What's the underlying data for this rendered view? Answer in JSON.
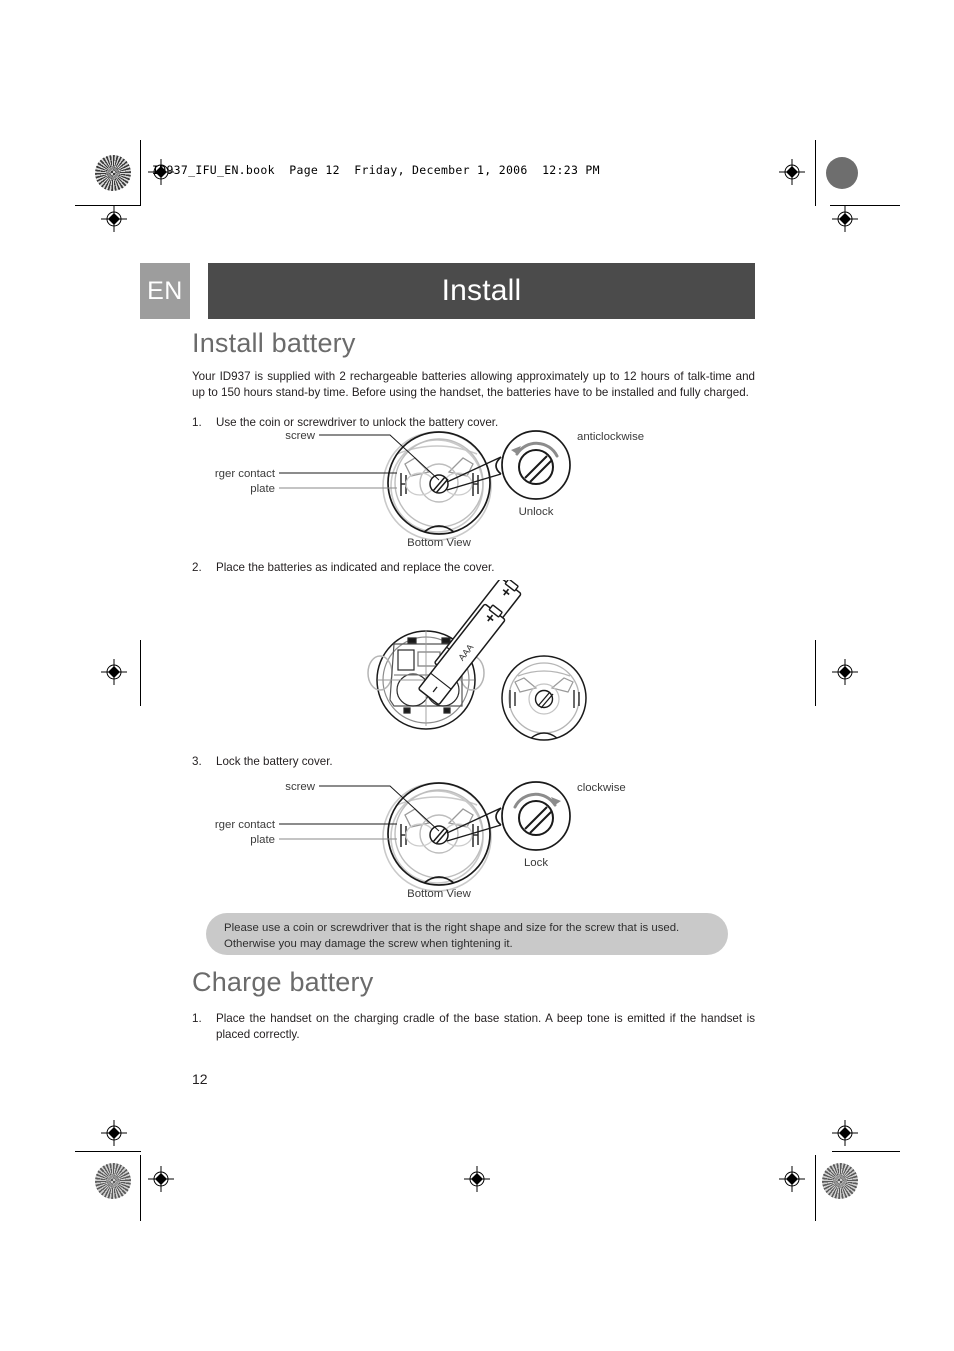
{
  "print_header": "ID937_IFU_EN.book  Page 12  Friday, December 1, 2006  12:23 PM",
  "band": {
    "lang_tab": "EN",
    "chapter_title": "Install"
  },
  "colors": {
    "band_dark": "#4b4b4b",
    "band_tab": "#9d9d9d",
    "heading_gray": "#6b6b6b",
    "note_bg": "#c9c9c9",
    "body_text": "#231f20"
  },
  "sections": [
    {
      "heading": "Install battery",
      "intro": "Your ID937 is supplied with 2 rechargeable batteries allowing approximately up to 12 hours of talk-time and up to 150 hours stand-by time. Before using the handset, the batteries have to be installed and fully charged.",
      "steps": [
        {
          "num": "1.",
          "text": "Use the coin or screwdriver to unlock the battery cover."
        },
        {
          "num": "2.",
          "text": "Place the batteries as indicated and replace the cover."
        },
        {
          "num": "3.",
          "text": "Lock the battery cover."
        }
      ]
    },
    {
      "heading": "Charge battery",
      "steps": [
        {
          "num": "1.",
          "text": "Place the handset on the charging cradle of the base station. A beep tone is emitted if the handset is placed correctly."
        }
      ]
    }
  ],
  "figures": {
    "unlock": {
      "label_screw": "screw",
      "label_contact_1": "charger contact",
      "label_contact_2": "plate",
      "label_direction": "anticlockwise",
      "label_action": "Unlock",
      "label_view": "Bottom View",
      "rotation": "counterclockwise"
    },
    "batteries": {
      "battery_count": 2,
      "polarity_marks": [
        "+",
        "+",
        "-",
        "-"
      ]
    },
    "lock": {
      "label_screw": "screw",
      "label_contact_1": "charger contact",
      "label_contact_2": "plate",
      "label_direction": "clockwise",
      "label_action": "Lock",
      "label_view": "Bottom View",
      "rotation": "clockwise"
    }
  },
  "note": "Please use a coin or screwdriver that is the right shape and size for the screw that is used.  Otherwise you may damage the screw when tightening it.",
  "page_number": "12"
}
